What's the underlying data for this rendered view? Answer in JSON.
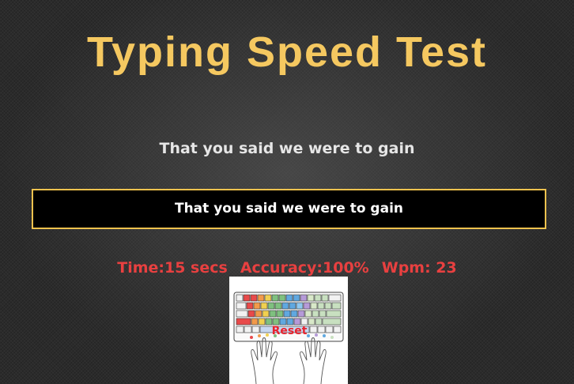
{
  "header": {
    "title": "Typing Speed Test"
  },
  "test": {
    "prompt_text": "That you said we were to gain",
    "input_value": "That you said we were to gain"
  },
  "stats": {
    "time": "Time:15 secs",
    "accuracy": "Accuracy:100%",
    "wpm": "Wpm: 23"
  },
  "controls": {
    "reset_label": "Reset"
  },
  "colors": {
    "title": "#f5c860",
    "input_border": "#f0c24e",
    "stats": "#e84040",
    "reset": "#e8232e"
  },
  "icons": {
    "keyboard": "keyboard-with-hands-icon"
  }
}
